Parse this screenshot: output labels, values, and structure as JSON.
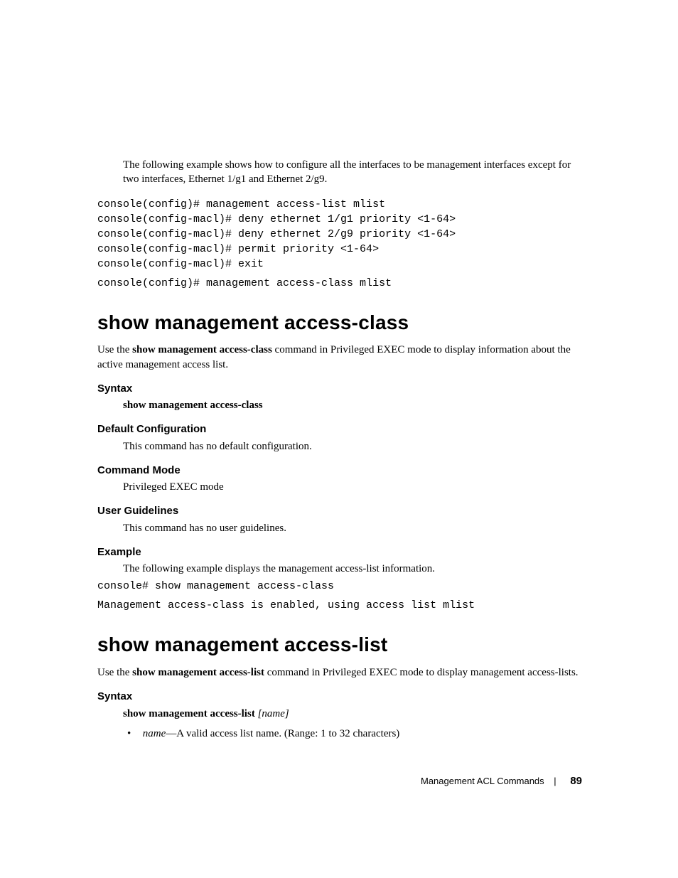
{
  "intro": "The following example shows how to configure all the interfaces to be management interfaces except for two interfaces, Ethernet 1/g1 and Ethernet 2/g9.",
  "code_intro": "console(config)# management access-list mlist\nconsole(config-macl)# deny ethernet 1/g1 priority <1-64>\nconsole(config-macl)# deny ethernet 2/g9 priority <1-64>\nconsole(config-macl)# permit priority <1-64>\nconsole(config-macl)# exit",
  "code_intro2": "console(config)# management access-class mlist",
  "sec1": {
    "title": "show management access-class",
    "desc1": "Use the ",
    "desc_cmd": "show management access-class",
    "desc2": " command in Privileged EXEC mode to display information about the active management access list.",
    "syntax_h": "Syntax",
    "syntax_cmd": "show management access-class",
    "defcfg_h": "Default Configuration",
    "defcfg": "This command has no default configuration.",
    "mode_h": "Command Mode",
    "mode": "Privileged EXEC mode",
    "ug_h": "User Guidelines",
    "ug": "This command has no user guidelines.",
    "ex_h": "Example",
    "ex_desc": "The following example displays the management access-list information.",
    "ex_code1": "console# show management access-class",
    "ex_code2": "Management access-class is enabled, using access list mlist"
  },
  "sec2": {
    "title": "show management access-list",
    "desc1": "Use the ",
    "desc_cmd": "show management access-list",
    "desc2": " command in Privileged EXEC mode to display management access-lists.",
    "syntax_h": "Syntax",
    "syntax_cmd": "show management access-list",
    "syntax_arg": " [name]",
    "bullet_kw": "name",
    "bullet_txt": "—A valid access list name. (Range: 1 to 32 characters)"
  },
  "footer": {
    "label": "Management ACL Commands",
    "page": "89"
  }
}
